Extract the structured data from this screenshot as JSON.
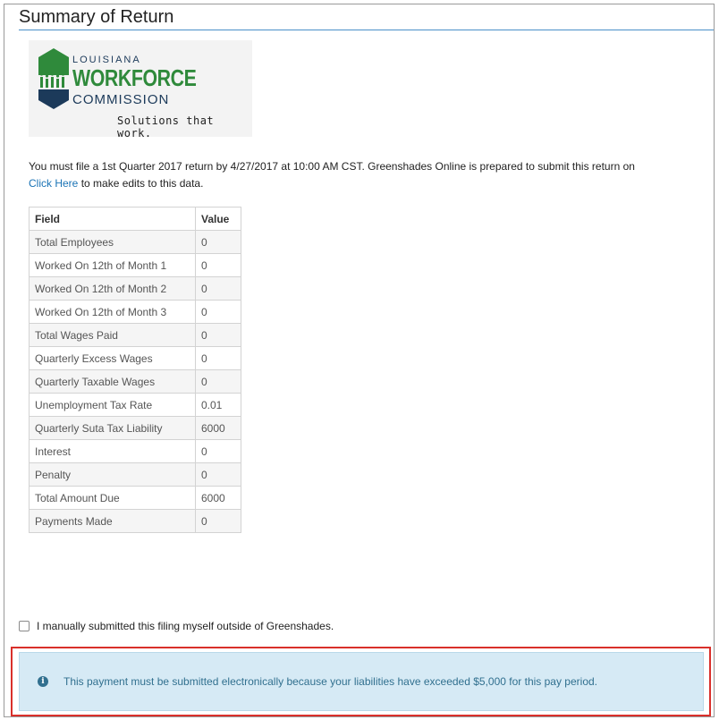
{
  "page": {
    "title": "Summary of Return"
  },
  "logo": {
    "line1": "LOUISIANA",
    "line2": "WORKFORCE",
    "line3": "COMMISSION",
    "tagline": "Solutions that work."
  },
  "notice": {
    "text": "You must file a 1st Quarter 2017 return by 4/27/2017 at 10:00 AM CST. Greenshades Online is prepared to submit this return on",
    "link_text": "Click Here",
    "link_suffix": "to make edits to this data."
  },
  "table": {
    "headers": [
      "Field",
      "Value"
    ],
    "rows": [
      [
        "Total Employees",
        "0"
      ],
      [
        "Worked On 12th of Month 1",
        "0"
      ],
      [
        "Worked On 12th of Month 2",
        "0"
      ],
      [
        "Worked On 12th of Month 3",
        "0"
      ],
      [
        "Total Wages Paid",
        "0"
      ],
      [
        "Quarterly Excess Wages",
        "0"
      ],
      [
        "Quarterly Taxable Wages",
        "0"
      ],
      [
        "Unemployment Tax Rate",
        "0.01"
      ],
      [
        "Quarterly Suta Tax Liability",
        "6000"
      ],
      [
        "Interest",
        "0"
      ],
      [
        "Penalty",
        "0"
      ],
      [
        "Total Amount Due",
        "6000"
      ],
      [
        "Payments Made",
        "0"
      ]
    ]
  },
  "manual_submission": {
    "label": "I manually submitted this filing myself outside of Greenshades.",
    "checked": false
  },
  "alert": {
    "icon": "info-icon",
    "message": "This payment must be submitted electronically because your liabilities have exceeded $5,000 for this pay period.",
    "highlight_color": "#d9302b"
  }
}
